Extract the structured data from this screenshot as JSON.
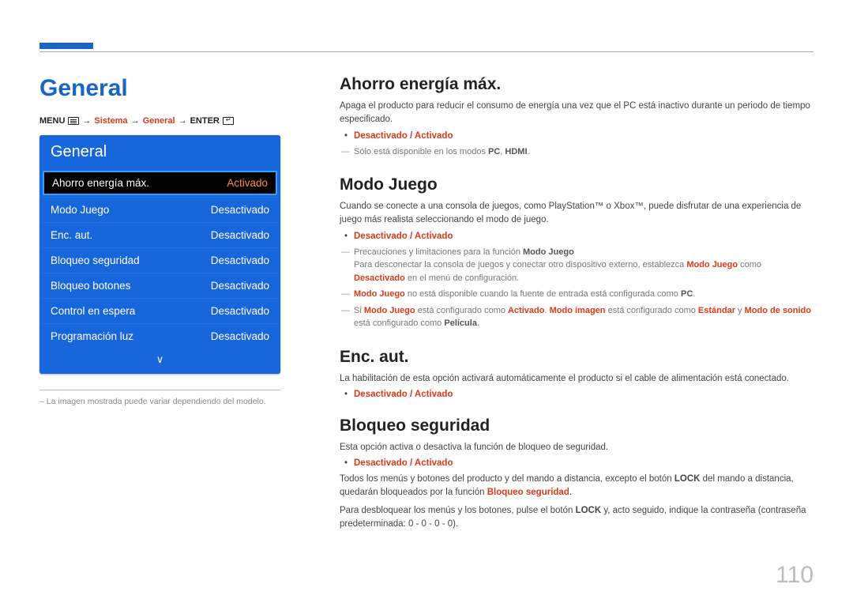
{
  "page_number": "110",
  "header": {
    "title": "General"
  },
  "breadcrumb": {
    "menu": "MENU",
    "sistema": "Sistema",
    "general": "General",
    "enter": "ENTER"
  },
  "menu": {
    "title": "General",
    "rows": [
      {
        "label": "Ahorro energía máx.",
        "value": "Activado",
        "selected": true
      },
      {
        "label": "Modo Juego",
        "value": "Desactivado",
        "selected": false
      },
      {
        "label": "Enc. aut.",
        "value": "Desactivado",
        "selected": false
      },
      {
        "label": "Bloqueo seguridad",
        "value": "Desactivado",
        "selected": false
      },
      {
        "label": "Bloqueo botones",
        "value": "Desactivado",
        "selected": false
      },
      {
        "label": "Control en espera",
        "value": "Desactivado",
        "selected": false
      },
      {
        "label": "Programación luz",
        "value": "Desactivado",
        "selected": false
      }
    ],
    "scroll_hint": "∨"
  },
  "footnote": "La imagen mostrada puede variar dependiendo del modelo.",
  "sections": {
    "ahorro": {
      "title": "Ahorro energía máx.",
      "desc": "Apaga el producto para reducir el consumo de energía una vez que el PC está inactivo durante un periodo de tiempo especificado.",
      "bullet": "Desactivado / Activado",
      "note1_a": "Sólo está disponible en los modos ",
      "note1_pc": "PC",
      "note1_sep": ", ",
      "note1_hdmi": "HDMI",
      "note1_end": "."
    },
    "modo": {
      "title": "Modo Juego",
      "desc": "Cuando se conecte a una consola de juegos, como PlayStation™ o Xbox™, puede disfrutar de una experiencia de juego más realista seleccionando el modo de juego.",
      "bullet": "Desactivado / Activado",
      "note1_a": "Precauciones y limitaciones para la función ",
      "note1_b": "Modo Juego",
      "note1_line2_a": "Para desconectar la consola de juegos y conectar otro dispositivo externo, establezca ",
      "note1_line2_b": "Modo Juego",
      "note1_line2_c": " como ",
      "note1_line2_d": "Desactivado",
      "note1_line2_e": " en el menú de configuración.",
      "note2_a": "Modo Juego",
      "note2_b": " no está disponible cuando la fuente de entrada está configurada como ",
      "note2_c": "PC",
      "note2_d": ".",
      "note3_a": "Si ",
      "note3_b": "Modo Juego",
      "note3_c": " está configurado como ",
      "note3_d": "Activado",
      "note3_e": ". ",
      "note3_f": "Modo imagen",
      "note3_g": " está configurado como ",
      "note3_h": "Estándar",
      "note3_i": " y ",
      "note3_j": "Modo de sonido",
      "note3_k": " está configurado como ",
      "note3_l": "Película",
      "note3_m": "."
    },
    "enc": {
      "title": "Enc. aut.",
      "desc": "La habilitación de esta opción activará automáticamente el producto si el cable de alimentación está conectado.",
      "bullet": "Desactivado / Activado"
    },
    "bloqueo": {
      "title": "Bloqueo seguridad",
      "desc": "Esta opción activa o desactiva la función de bloqueo de seguridad.",
      "bullet": "Desactivado / Activado",
      "p2_a": "Todos los menús y botones del producto y del mando a distancia, excepto el botón ",
      "p2_b": "LOCK",
      "p2_c": " del mando a distancia, quedarán bloqueados por la función ",
      "p2_d": "Bloqueo seguridad",
      "p2_e": ".",
      "p3_a": "Para desbloquear los menús y los botones, pulse el botón ",
      "p3_b": "LOCK",
      "p3_c": " y, acto seguido, indique la contraseña (contraseña predeterminada: 0 - 0 - 0 - 0)."
    }
  }
}
